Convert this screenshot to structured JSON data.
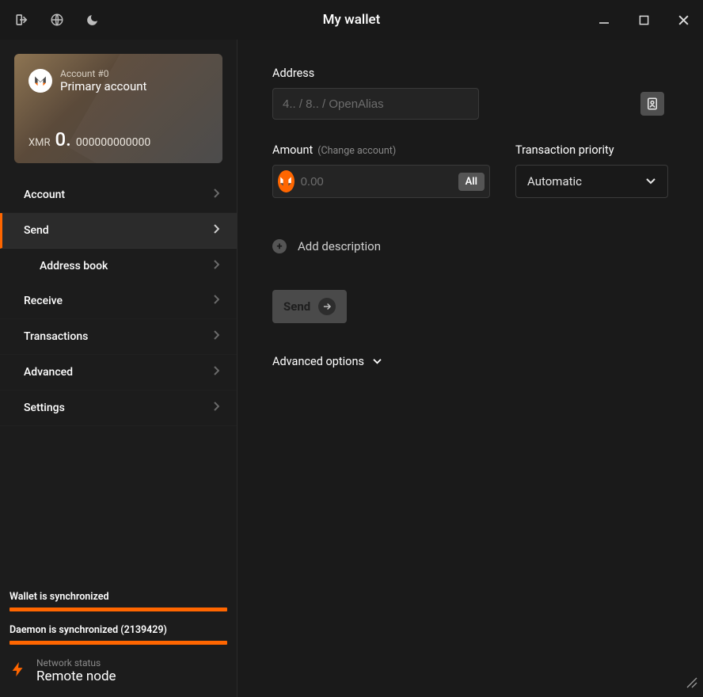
{
  "window": {
    "title": "My wallet"
  },
  "account_card": {
    "number_label": "Account #0",
    "name": "Primary account",
    "currency": "XMR",
    "balance_whole": "0.",
    "balance_frac": "000000000000"
  },
  "nav": {
    "account": "Account",
    "send": "Send",
    "address_book": "Address book",
    "receive": "Receive",
    "transactions": "Transactions",
    "advanced": "Advanced",
    "settings": "Settings"
  },
  "sync": {
    "wallet_label": "Wallet is synchronized",
    "daemon_label": "Daemon is synchronized (2139429)"
  },
  "network": {
    "label": "Network status",
    "value": "Remote node"
  },
  "send_form": {
    "address_label": "Address",
    "address_placeholder": "4.. / 8.. / OpenAlias",
    "amount_label": "Amount",
    "change_account_hint": "(Change account)",
    "amount_placeholder": "0.00",
    "all_button": "All",
    "priority_label": "Transaction priority",
    "priority_value": "Automatic",
    "add_description": "Add description",
    "send_button": "Send",
    "advanced_options": "Advanced options"
  }
}
